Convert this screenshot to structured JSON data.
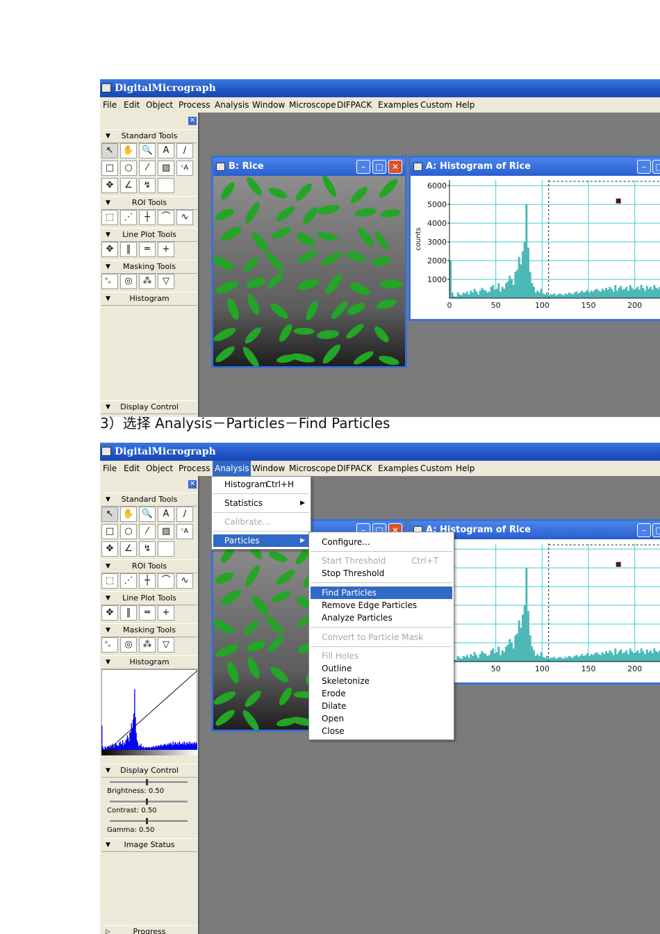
{
  "app": {
    "title": "DigitalMicrograph"
  },
  "menu": [
    "File",
    "Edit",
    "Object",
    "Process",
    "Analysis",
    "Window",
    "Microscope",
    "DIFPACK",
    "Examples",
    "Custom",
    "Help"
  ],
  "palette": {
    "standard_tools": "Standard Tools",
    "roi_tools": "ROI Tools",
    "line_plot_tools": "Line Plot Tools",
    "masking_tools": "Masking Tools",
    "histogram": "Histogram",
    "display_control": "Display Control",
    "image_status": "Image Status",
    "progress": "Progress",
    "brightness": "Brightness: 0.50",
    "contrast": "Contrast: 0.50",
    "gamma": "Gamma: 0.50",
    "close_glyph": "✕"
  },
  "tool_glyphs": {
    "standard": [
      "↖",
      "✋",
      "🔍",
      "A",
      "∕",
      "□",
      "○",
      "⁄",
      "▨",
      "ᶜA",
      "✥",
      "∠",
      "↯",
      ""
    ],
    "roi": [
      "⬚",
      "⋰",
      "┼",
      "⌒",
      "∿"
    ],
    "lineplot": [
      "✥",
      "‖",
      "═",
      "+"
    ],
    "masking": [
      "°。",
      "◎",
      "⁂",
      "▽"
    ]
  },
  "window_rice": {
    "title": "B: Rice"
  },
  "window_hist": {
    "title": "A: Histogram of Rice"
  },
  "chart_data": {
    "type": "area",
    "title": "",
    "xlabel": "",
    "ylabel": "counts",
    "xlim": [
      0,
      240
    ],
    "ylim": [
      0,
      6300
    ],
    "xticks": [
      0,
      50,
      100,
      150,
      200
    ],
    "yticks": [
      1000,
      2000,
      3000,
      4000,
      5000,
      6000
    ],
    "grid": true,
    "threshold_x": 107,
    "x": [
      0,
      2,
      4,
      6,
      8,
      10,
      12,
      14,
      16,
      18,
      20,
      22,
      24,
      26,
      28,
      30,
      32,
      34,
      36,
      38,
      40,
      42,
      44,
      46,
      48,
      50,
      52,
      54,
      56,
      58,
      60,
      62,
      64,
      66,
      68,
      70,
      72,
      74,
      76,
      78,
      80,
      82,
      84,
      86,
      88,
      90,
      92,
      94,
      96,
      98,
      100,
      102,
      104,
      106,
      108,
      110,
      112,
      114,
      116,
      118,
      120,
      122,
      124,
      126,
      128,
      130,
      132,
      134,
      136,
      138,
      140,
      142,
      144,
      146,
      148,
      150,
      152,
      154,
      156,
      158,
      160,
      162,
      164,
      166,
      168,
      170,
      172,
      174,
      176,
      178,
      180,
      182,
      184,
      186,
      188,
      190,
      192,
      194,
      196,
      198,
      200,
      202,
      204,
      206,
      208,
      210,
      212,
      214,
      216,
      218,
      220,
      222,
      224,
      226,
      228,
      230,
      232,
      234,
      236,
      238
    ],
    "values": [
      2000,
      300,
      100,
      80,
      300,
      200,
      150,
      300,
      250,
      350,
      200,
      400,
      300,
      500,
      350,
      200,
      400,
      550,
      450,
      400,
      300,
      350,
      600,
      700,
      450,
      500,
      800,
      350,
      600,
      500,
      800,
      900,
      1200,
      1000,
      700,
      1400,
      1500,
      2200,
      1800,
      2500,
      3000,
      5000,
      2700,
      1400,
      800,
      600,
      300,
      400,
      300,
      500,
      250,
      200,
      300,
      150,
      200,
      200,
      250,
      150,
      200,
      250,
      200,
      150,
      250,
      200,
      300,
      250,
      200,
      300,
      350,
      250,
      300,
      400,
      300,
      350,
      450,
      300,
      400,
      350,
      450,
      500,
      400,
      350,
      500,
      400,
      550,
      450,
      600,
      500,
      350,
      700,
      400,
      550,
      650,
      450,
      500,
      600,
      400,
      700,
      550,
      450,
      500,
      600,
      450,
      700,
      550,
      400,
      650,
      500,
      600,
      450,
      700,
      550,
      500,
      600,
      450,
      550,
      650,
      500,
      600,
      550
    ]
  },
  "colors": {
    "accent": "#3169c6",
    "hist_fill": "#4db8b8",
    "grid": "#3fcbd6"
  },
  "caption": "3）选择 Analysis－Particles－Find Particles",
  "analysis_menu": {
    "items": [
      {
        "label": "Histogram",
        "shortcut": "Ctrl+H"
      },
      {
        "label": "Statistics",
        "arrow": "▶"
      },
      {
        "label": "Calibrate...",
        "disabled": true
      },
      {
        "label": "Particles",
        "arrow": "▶",
        "highlight": true
      }
    ]
  },
  "particles_menu": {
    "items": [
      {
        "label": "Configure..."
      },
      {
        "label": "Start Threshold",
        "shortcut": "Ctrl+T",
        "disabled": true
      },
      {
        "label": "Stop Threshold"
      },
      {
        "label": "Find Particles",
        "highlight": true
      },
      {
        "label": "Remove Edge Particles"
      },
      {
        "label": "Analyze Particles"
      },
      {
        "label": "Convert to Particle Mask",
        "disabled": true
      },
      {
        "label": "Fill Holes",
        "disabled": true
      },
      {
        "label": "Outline"
      },
      {
        "label": "Skeletonize"
      },
      {
        "label": "Erode"
      },
      {
        "label": "Dilate"
      },
      {
        "label": "Open"
      },
      {
        "label": "Close"
      }
    ]
  }
}
